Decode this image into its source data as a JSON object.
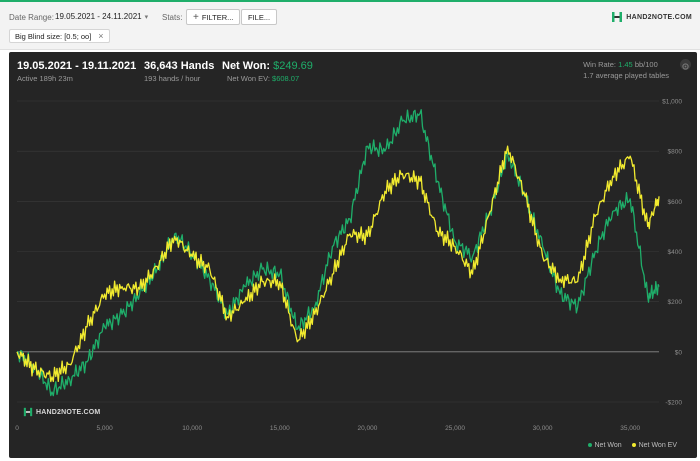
{
  "toolbar": {
    "date_range_label": "Date Range:",
    "date_range_value": "19.05.2021 - 24.11.2021",
    "stats_label": "Stats:",
    "filter_button": "FILTER...",
    "file_button": "FILE...",
    "filter_chip": "Big Blind size: [0.5; oo]",
    "brand": "HAND2NOTE.COM"
  },
  "summary": {
    "period": "19.05.2021 - 19.11.2021",
    "active": "Active 189h 23m",
    "hands": "36,643 Hands",
    "hands_rate": "193 hands / hour",
    "net_won_label": "Net Won:",
    "net_won_value": "$249.69",
    "net_won_ev_label": "Net Won  EV:",
    "net_won_ev_value": "$608.07",
    "win_rate_label": "Win Rate:",
    "win_rate_value": "1.45",
    "win_rate_unit": "bb/100",
    "tables": "1.7 average played tables"
  },
  "watermark": "HAND2NOTE.COM",
  "colors": {
    "accent": "#1fae6a",
    "ev": "#f2eb2f",
    "panel": "#252525"
  },
  "chart_data": {
    "type": "line",
    "x_ticks": [
      "0",
      "5,000",
      "10,000",
      "15,000",
      "20,000",
      "25,000",
      "30,000",
      "35,000"
    ],
    "y_ticks": [
      "$1,000",
      "$800",
      "$600",
      "$400",
      "$200",
      "$0",
      "-$200"
    ],
    "xlim": [
      0,
      36643
    ],
    "ylim": [
      -200,
      1000
    ],
    "grid": true,
    "legend_position": "bottom-right",
    "series": [
      {
        "name": "Net Won",
        "color": "#1fae6a",
        "x": [
          0,
          1000,
          2000,
          3000,
          4000,
          5000,
          6000,
          7000,
          8000,
          9000,
          10000,
          11000,
          12000,
          13000,
          14000,
          15000,
          16000,
          17000,
          18000,
          19000,
          20000,
          21000,
          22000,
          23000,
          24000,
          25000,
          26000,
          27000,
          28000,
          29000,
          30000,
          31000,
          32000,
          33000,
          34000,
          35000,
          36000,
          36643
        ],
        "y": [
          0,
          -60,
          -160,
          -110,
          -40,
          100,
          150,
          230,
          330,
          470,
          390,
          290,
          150,
          260,
          330,
          310,
          90,
          180,
          420,
          530,
          820,
          800,
          920,
          950,
          680,
          440,
          380,
          560,
          790,
          620,
          420,
          230,
          180,
          400,
          560,
          610,
          220,
          260
        ]
      },
      {
        "name": "Net Won  EV",
        "color": "#f2eb2f",
        "x": [
          0,
          1000,
          2000,
          3000,
          4000,
          5000,
          6000,
          7000,
          8000,
          9000,
          10000,
          11000,
          12000,
          13000,
          14000,
          15000,
          16000,
          17000,
          18000,
          19000,
          20000,
          21000,
          22000,
          23000,
          24000,
          25000,
          26000,
          27000,
          28000,
          29000,
          30000,
          31000,
          32000,
          33000,
          34000,
          35000,
          36000,
          36643
        ],
        "y": [
          0,
          -70,
          -100,
          -50,
          100,
          230,
          260,
          250,
          340,
          460,
          380,
          330,
          140,
          200,
          280,
          280,
          40,
          150,
          310,
          470,
          460,
          640,
          710,
          680,
          480,
          420,
          310,
          560,
          820,
          620,
          380,
          290,
          280,
          540,
          700,
          780,
          500,
          620
        ]
      }
    ]
  }
}
